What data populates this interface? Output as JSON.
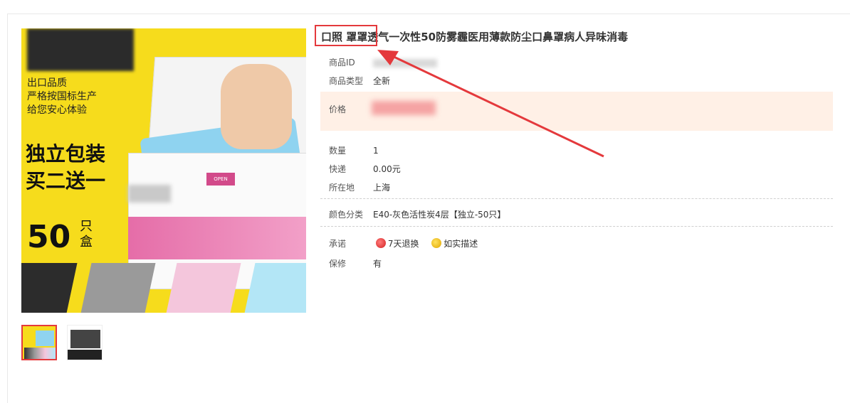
{
  "product": {
    "title": "口照 罩罩透气一次性50防雾霾医用薄款防尘口鼻罩病人异味消毒",
    "image_text": {
      "quality_lines": [
        "出口品质",
        "严格按国标生产",
        "给您安心体验"
      ],
      "promo_lines": [
        "独立包装",
        "买二送一"
      ],
      "count": "50",
      "count_unit_lines": [
        "只",
        "盒"
      ],
      "open_tab": "OPEN"
    }
  },
  "properties": {
    "id_label": "商品ID",
    "type_label": "商品类型",
    "type_value": "全新",
    "price_label": "价格",
    "qty_label": "数量",
    "qty_value": "1",
    "shipping_label": "快递",
    "shipping_value": "0.00元",
    "location_label": "所在地",
    "location_value": "上海",
    "color_label": "颜色分类",
    "color_value": "E40-灰色活性炭4层【独立-50只】",
    "promise_label": "承诺",
    "promise_items": [
      "7天退换",
      "如实描述"
    ],
    "warranty_label": "保修",
    "warranty_value": "有"
  },
  "colors": {
    "highlight": "#e4393c",
    "price_band": "#fff0e6",
    "product_yellow": "#f6dc1c"
  }
}
